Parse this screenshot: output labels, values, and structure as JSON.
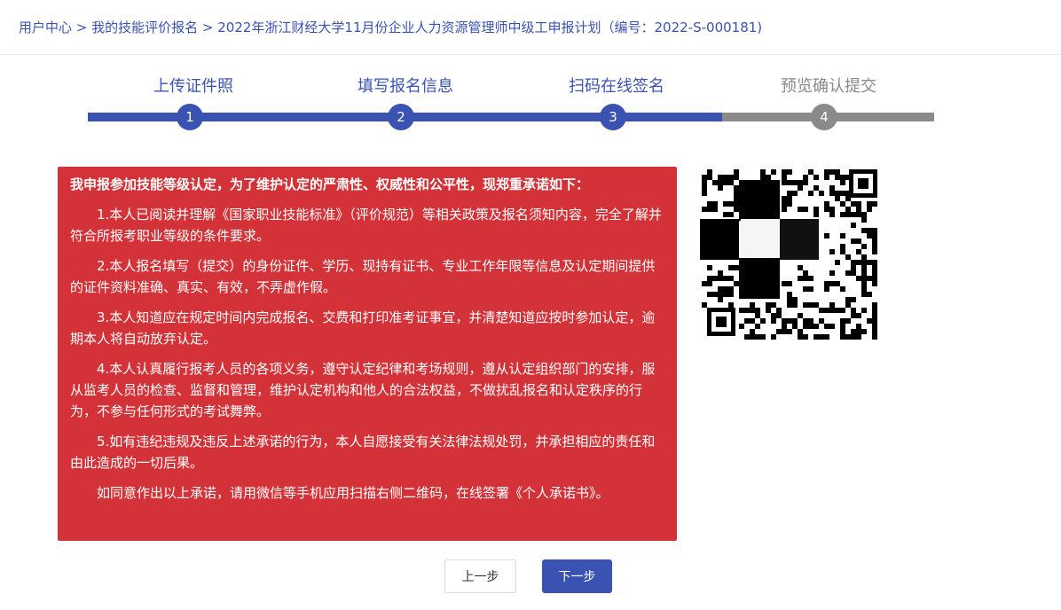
{
  "breadcrumb": {
    "item1": "用户中心",
    "sep": " > ",
    "item2": "我的技能评价报名",
    "item3": "2022年浙江财经大学11月份企业人力资源管理师中级工申报计划（编号：2022-S-000181)"
  },
  "steps": [
    {
      "label": "上传证件照",
      "number": "1",
      "status": "done"
    },
    {
      "label": "填写报名信息",
      "number": "2",
      "status": "done"
    },
    {
      "label": "扫码在线签名",
      "number": "3",
      "status": "current"
    },
    {
      "label": "预览确认提交",
      "number": "4",
      "status": "pending"
    }
  ],
  "pledge": {
    "title": "我申报参加技能等级认定，为了维护认定的严肃性、权威性和公平性，现郑重承诺如下：",
    "items": [
      "1.本人已阅读并理解《国家职业技能标准》（评价规范）等相关政策及报名须知内容，完全了解并符合所报考职业等级的条件要求。",
      "2.本人报名填写（提交）的身份证件、学历、现持有证书、专业工作年限等信息及认定期间提供的证件资料准确、真实、有效，不弄虚作假。",
      "3.本人知道应在规定时间内完成报名、交费和打印准考证事宜，并清楚知道应按时参加认定，逾期本人将自动放弃认定。",
      "4.本人认真履行报考人员的各项义务，遵守认定纪律和考场规则，遵从认定组织部门的安排，服从监考人员的检查、监督和管理，维护认定机构和他人的合法权益，不做扰乱报名和认定秩序的行为，不参与任何形式的考试舞弊。",
      "5.如有违纪违规及违反上述承诺的行为，本人自愿接受有关法律法规处罚，并承担相应的责任和由此造成的一切后果。",
      "如同意作出以上承诺，请用微信等手机应用扫描右侧二维码，在线签署《个人承诺书》。"
    ]
  },
  "qr": {
    "icon": "qr-code-icon"
  },
  "buttons": {
    "prev": "上一步",
    "next": "下一步"
  },
  "colors": {
    "accent": "#3a53b3",
    "pledge_bg": "#d33338",
    "inactive": "#8a8a8a"
  }
}
